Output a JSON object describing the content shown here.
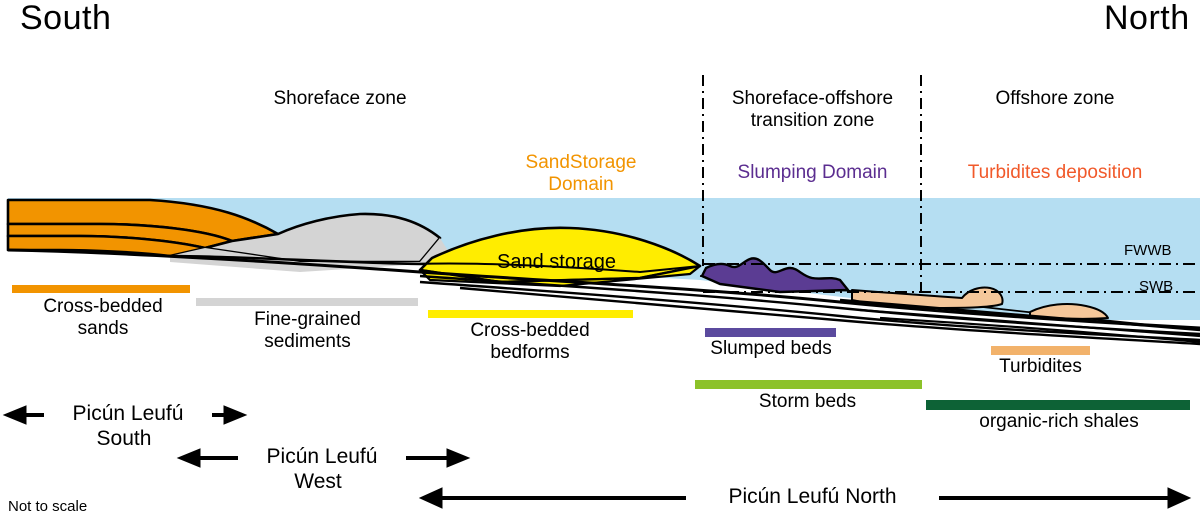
{
  "compass": {
    "south": "South",
    "north": "North"
  },
  "zones": [
    {
      "id": "shoreface",
      "label": "Shoreface zone"
    },
    {
      "id": "transition",
      "label": "Shoreface-offshore\ntransition zone"
    },
    {
      "id": "offshore",
      "label": "Offshore zone"
    }
  ],
  "domains": [
    {
      "id": "sand-storage",
      "label": "SandStorage\nDomain",
      "color": "#F29400"
    },
    {
      "id": "slumping",
      "label": "Slumping Domain",
      "color": "#5B2D90"
    },
    {
      "id": "turbidites",
      "label": "Turbidites deposition",
      "color": "#F1592A"
    }
  ],
  "in_section_labels": [
    {
      "id": "sand-storage-body",
      "label": "Sand storage"
    }
  ],
  "wave_bases": [
    {
      "id": "fwwb",
      "label": "FWWB"
    },
    {
      "id": "swb",
      "label": "SWB"
    }
  ],
  "legend": [
    {
      "id": "cross-bedded-sands",
      "label": "Cross-bedded\nsands",
      "color": "#F29400"
    },
    {
      "id": "fine-grained-sediments",
      "label": "Fine-grained\nsediments",
      "color": "#D4D4D4"
    },
    {
      "id": "cross-bedded-bedforms",
      "label": "Cross-bedded\nbedforms",
      "color": "#FFED00"
    },
    {
      "id": "slumped-beds",
      "label": "Slumped beds",
      "color": "#5B4A9E"
    },
    {
      "id": "storm-beds",
      "label": "Storm beds",
      "color": "#8CC229"
    },
    {
      "id": "turbidites",
      "label": "Turbidites",
      "color": "#F2B26B"
    },
    {
      "id": "organic-rich-shales",
      "label": "organic-rich shales",
      "color": "#0D6236"
    }
  ],
  "extent_arrows": [
    {
      "id": "picun-leufu-south",
      "label": "Picún Leufú",
      "sublabel": "South"
    },
    {
      "id": "picun-leufu-west",
      "label": "Picún Leufú",
      "sublabel": "West"
    },
    {
      "id": "picun-leufu-north",
      "label": "Picún Leufú North",
      "sublabel": ""
    }
  ],
  "footnote": "Not to scale",
  "colors": {
    "water": "#B5DEF2",
    "sand_orange": "#F29400",
    "fine_gray": "#D4D4D4",
    "sand_yellow": "#FFED00",
    "slump_purple": "#5B3C93",
    "turbidite_tan": "#F5C79A",
    "outline": "#000000"
  }
}
